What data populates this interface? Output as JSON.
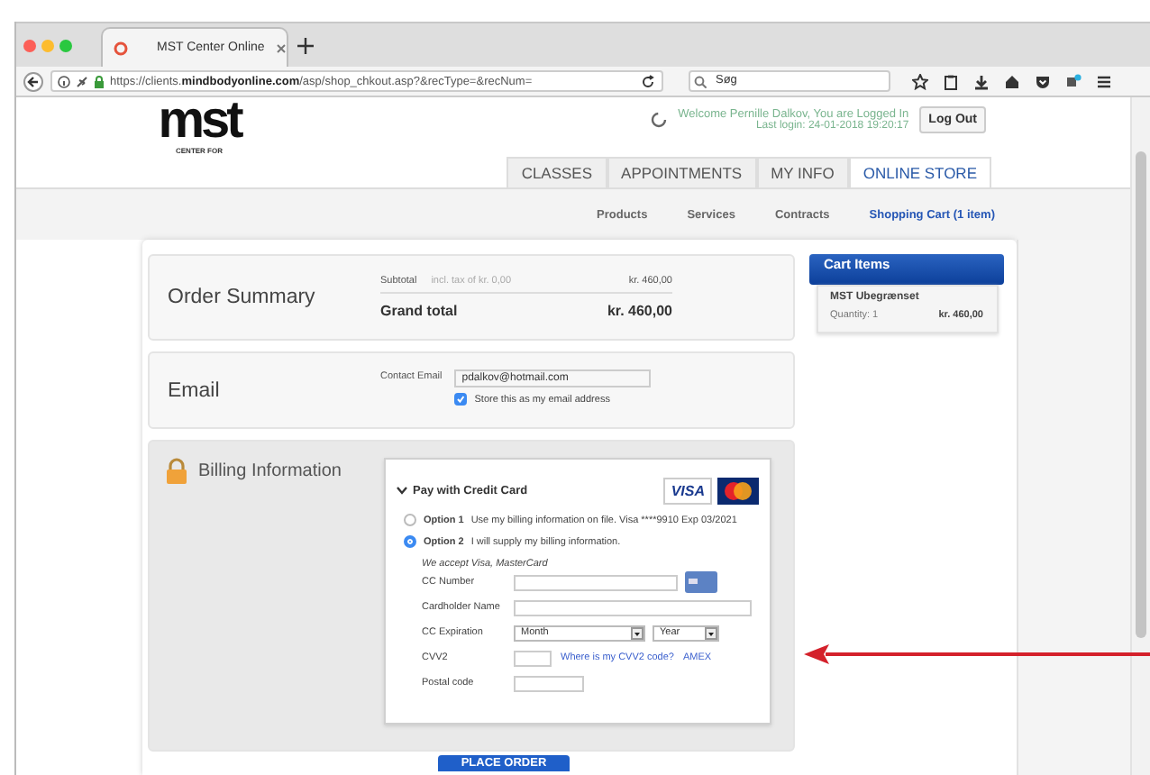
{
  "browser": {
    "tab_title": "MST Center Online",
    "url": "https://clients.**mindbodyonline.com**/asp/shop_chkout.asp?&recType=&recNum=",
    "search": {
      "placeholder": "Søg"
    }
  },
  "header": {
    "logo": {
      "mark": "mst",
      "subtitle": "CENTER FOR"
    },
    "welcome": "Welcome Pernille Dalkov, You are Logged In",
    "last_login": "Last login: 24-01-2018 19:20:17",
    "logout": "Log Out"
  },
  "nav_tabs": [
    {
      "label": "CLASSES",
      "selected": false
    },
    {
      "label": "APPOINTMENTS",
      "selected": false
    },
    {
      "label": "MY INFO",
      "selected": false
    },
    {
      "label": "ONLINE STORE",
      "selected": true
    }
  ],
  "subnav": [
    {
      "label": "Products",
      "selected": false
    },
    {
      "label": "Services",
      "selected": false
    },
    {
      "label": "Contracts",
      "selected": false
    },
    {
      "label": "Shopping Cart (1 item)",
      "selected": true
    }
  ],
  "order_summary": {
    "title": "Order Summary",
    "subtotal_label": "Subtotal",
    "tax_note": "incl. tax of kr. 0,00",
    "subtotal": "kr. 460,00",
    "grand_total_label": "Grand total",
    "grand_total": "kr. 460,00"
  },
  "email": {
    "title": "Email",
    "label": "Contact Email",
    "value": "pdalkov@hotmail.com",
    "store": {
      "label": "Store this as my email address",
      "checked": true
    }
  },
  "billing": {
    "title": "Billing Information",
    "method": {
      "label": "Pay with Credit Card",
      "expanded": true,
      "card_logos": [
        "VISA"
      ]
    },
    "options": [
      {
        "label": "Option 1",
        "text": "Use my billing information on file. Visa ****9910 Exp 03/2021",
        "selected": false
      },
      {
        "label": "Option 2",
        "text": "I will supply my billing information.",
        "selected": true
      }
    ],
    "accepted": "We accept Visa, MasterCard",
    "fields": [
      {
        "label": "CC Number",
        "kind": "card"
      },
      {
        "label": "Cardholder Name",
        "kind": "wide"
      },
      {
        "label": "CC Expiration",
        "kind": "selects",
        "selects": [
          "Month",
          "Year"
        ]
      },
      {
        "label": "CVV2",
        "kind": "cvv",
        "links": [
          "Where is my CVV2 code?",
          "AMEX"
        ]
      },
      {
        "label": "Postal code",
        "kind": "short"
      }
    ]
  },
  "cart": {
    "title": "Cart Items",
    "items": [
      {
        "name": "MST Ubegrænset",
        "quantity": "Quantity: 1",
        "price": "kr. 460,00"
      }
    ]
  },
  "place_order": "PLACE ORDER"
}
